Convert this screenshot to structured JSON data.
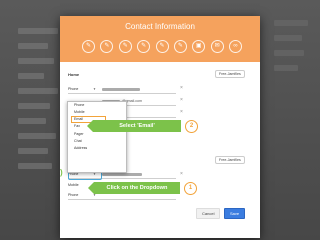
{
  "dialog": {
    "title": "Contact Information",
    "header_icons": [
      "pencil-icon",
      "pencil-icon",
      "pencil-icon",
      "pencil-icon",
      "pencil-icon",
      "pencil-icon",
      "photo-icon",
      "envelope-icon",
      "link-icon"
    ]
  },
  "section1": {
    "label": "Home",
    "type_select": "Free-Jamfiles",
    "rows": [
      {
        "type": "Phone",
        "value": ""
      },
      {
        "type": "",
        "value": "@gmail.com"
      },
      {
        "type": "",
        "value": ""
      }
    ]
  },
  "section2": {
    "type_select": "Free-Jamfiles",
    "rows": [
      {
        "type": "Phone",
        "value": ""
      },
      {
        "type": "Mobile",
        "value": ""
      },
      {
        "type": "Phone",
        "value": ""
      }
    ]
  },
  "dropdown": {
    "items": [
      "Phone",
      "Mobile",
      "Email",
      "Fax",
      "Pager",
      "Chat",
      "Address"
    ],
    "selected": "Email"
  },
  "callouts": {
    "step2_text": "Select 'Email'",
    "step2_num": "2",
    "step1_text": "Click on the Dropdown",
    "step1_num": "1"
  },
  "buttons": {
    "cancel": "Cancel",
    "save": "Save"
  },
  "colors": {
    "accent": "#f5a25d",
    "callout": "#7cc24a",
    "save": "#3b7de0"
  }
}
